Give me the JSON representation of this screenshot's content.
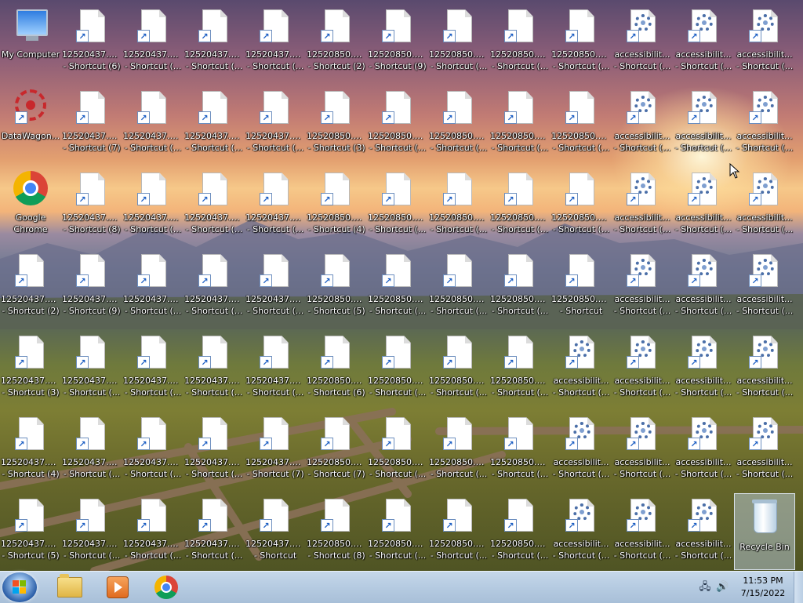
{
  "desktop": {
    "icons": [
      {
        "label1": "My Computer",
        "label2": "",
        "type": "computer"
      },
      {
        "label1": "12520437.cpx",
        "label2": "- Shortcut (6)",
        "type": "doc"
      },
      {
        "label1": "12520437.cpx",
        "label2": "- Shortcut (...",
        "type": "doc"
      },
      {
        "label1": "12520437.cpx",
        "label2": "- Shortcut (...",
        "type": "doc"
      },
      {
        "label1": "12520437.cpx",
        "label2": "- Shortcut (...",
        "type": "doc"
      },
      {
        "label1": "12520850.cpx",
        "label2": "- Shortcut (2)",
        "type": "doc"
      },
      {
        "label1": "12520850.cpx",
        "label2": "- Shortcut (9)",
        "type": "doc"
      },
      {
        "label1": "12520850.cpx",
        "label2": "- Shortcut (...",
        "type": "doc"
      },
      {
        "label1": "12520850.cpx",
        "label2": "- Shortcut (...",
        "type": "doc"
      },
      {
        "label1": "12520850.cpx",
        "label2": "- Shortcut (...",
        "type": "doc"
      },
      {
        "label1": "accessibilit...",
        "label2": "- Shortcut (...",
        "type": "gear"
      },
      {
        "label1": "accessibilit...",
        "label2": "- Shortcut (...",
        "type": "gear"
      },
      {
        "label1": "accessibilit...",
        "label2": "- Shortcut (...",
        "type": "gear"
      },
      {
        "label1": "DataWagon...",
        "label2": "",
        "type": "datawagon"
      },
      {
        "label1": "12520437.cpx",
        "label2": "- Shortcut (7)",
        "type": "doc"
      },
      {
        "label1": "12520437.cpx",
        "label2": "- Shortcut (...",
        "type": "doc"
      },
      {
        "label1": "12520437.cpx",
        "label2": "- Shortcut (...",
        "type": "doc"
      },
      {
        "label1": "12520437.cpx",
        "label2": "- Shortcut (...",
        "type": "doc"
      },
      {
        "label1": "12520850.cpx",
        "label2": "- Shortcut (3)",
        "type": "doc"
      },
      {
        "label1": "12520850.cpx",
        "label2": "- Shortcut (...",
        "type": "doc"
      },
      {
        "label1": "12520850.cpx",
        "label2": "- Shortcut (...",
        "type": "doc"
      },
      {
        "label1": "12520850.cpx",
        "label2": "- Shortcut (...",
        "type": "doc"
      },
      {
        "label1": "12520850.cpx",
        "label2": "- Shortcut (...",
        "type": "doc"
      },
      {
        "label1": "accessibilit...",
        "label2": "- Shortcut (...",
        "type": "gear"
      },
      {
        "label1": "accessibilit...",
        "label2": "- Shortcut (...",
        "type": "gear"
      },
      {
        "label1": "accessibilit...",
        "label2": "- Shortcut (...",
        "type": "gear"
      },
      {
        "label1": "Google",
        "label2": "Chrome",
        "type": "chrome"
      },
      {
        "label1": "12520437.cpx",
        "label2": "- Shortcut (8)",
        "type": "doc"
      },
      {
        "label1": "12520437.cpx",
        "label2": "- Shortcut (...",
        "type": "doc"
      },
      {
        "label1": "12520437.cpx",
        "label2": "- Shortcut (...",
        "type": "doc"
      },
      {
        "label1": "12520437.cpx",
        "label2": "- Shortcut (...",
        "type": "doc"
      },
      {
        "label1": "12520850.cpx",
        "label2": "- Shortcut (4)",
        "type": "doc"
      },
      {
        "label1": "12520850.cpx",
        "label2": "- Shortcut (...",
        "type": "doc"
      },
      {
        "label1": "12520850.cpx",
        "label2": "- Shortcut (...",
        "type": "doc"
      },
      {
        "label1": "12520850.cpx",
        "label2": "- Shortcut (...",
        "type": "doc"
      },
      {
        "label1": "12520850.cpx",
        "label2": "- Shortcut (...",
        "type": "doc"
      },
      {
        "label1": "accessibilit...",
        "label2": "- Shortcut (...",
        "type": "gear"
      },
      {
        "label1": "accessibilit...",
        "label2": "- Shortcut (...",
        "type": "gear"
      },
      {
        "label1": "accessibilit...",
        "label2": "- Shortcut (...",
        "type": "gear"
      },
      {
        "label1": "12520437.cpx",
        "label2": "- Shortcut (2)",
        "type": "doc"
      },
      {
        "label1": "12520437.cpx",
        "label2": "- Shortcut (9)",
        "type": "doc"
      },
      {
        "label1": "12520437.cpx",
        "label2": "- Shortcut (...",
        "type": "doc"
      },
      {
        "label1": "12520437.cpx",
        "label2": "- Shortcut (...",
        "type": "doc"
      },
      {
        "label1": "12520437.cpx",
        "label2": "- Shortcut (...",
        "type": "doc"
      },
      {
        "label1": "12520850.cpx",
        "label2": "- Shortcut (5)",
        "type": "doc"
      },
      {
        "label1": "12520850.cpx",
        "label2": "- Shortcut (...",
        "type": "doc"
      },
      {
        "label1": "12520850.cpx",
        "label2": "- Shortcut (...",
        "type": "doc"
      },
      {
        "label1": "12520850.cpx",
        "label2": "- Shortcut (...",
        "type": "doc"
      },
      {
        "label1": "12520850.cpx",
        "label2": "- Shortcut",
        "type": "doc"
      },
      {
        "label1": "accessibilit...",
        "label2": "- Shortcut (...",
        "type": "gear"
      },
      {
        "label1": "accessibilit...",
        "label2": "- Shortcut (...",
        "type": "gear"
      },
      {
        "label1": "accessibilit...",
        "label2": "- Shortcut (...",
        "type": "gear"
      },
      {
        "label1": "12520437.cpx",
        "label2": "- Shortcut (3)",
        "type": "doc"
      },
      {
        "label1": "12520437.cpx",
        "label2": "- Shortcut (...",
        "type": "doc"
      },
      {
        "label1": "12520437.cpx",
        "label2": "- Shortcut (...",
        "type": "doc"
      },
      {
        "label1": "12520437.cpx",
        "label2": "- Shortcut (...",
        "type": "doc"
      },
      {
        "label1": "12520437.cpx",
        "label2": "- Shortcut (...",
        "type": "doc"
      },
      {
        "label1": "12520850.cpx",
        "label2": "- Shortcut (6)",
        "type": "doc"
      },
      {
        "label1": "12520850.cpx",
        "label2": "- Shortcut (...",
        "type": "doc"
      },
      {
        "label1": "12520850.cpx",
        "label2": "- Shortcut (...",
        "type": "doc"
      },
      {
        "label1": "12520850.cpx",
        "label2": "- Shortcut (...",
        "type": "doc"
      },
      {
        "label1": "accessibilit...",
        "label2": "- Shortcut (...",
        "type": "gear"
      },
      {
        "label1": "accessibilit...",
        "label2": "- Shortcut (...",
        "type": "gear"
      },
      {
        "label1": "accessibilit...",
        "label2": "- Shortcut (...",
        "type": "gear"
      },
      {
        "label1": "accessibilit...",
        "label2": "- Shortcut (...",
        "type": "gear"
      },
      {
        "label1": "12520437.cpx",
        "label2": "- Shortcut (4)",
        "type": "doc"
      },
      {
        "label1": "12520437.cpx",
        "label2": "- Shortcut (...",
        "type": "doc"
      },
      {
        "label1": "12520437.cpx",
        "label2": "- Shortcut (...",
        "type": "doc"
      },
      {
        "label1": "12520437.cpx",
        "label2": "- Shortcut (...",
        "type": "doc"
      },
      {
        "label1": "12520437.cpx",
        "label2": "- Shortcut (7)",
        "type": "doc"
      },
      {
        "label1": "12520850.cpx",
        "label2": "- Shortcut (7)",
        "type": "doc"
      },
      {
        "label1": "12520850.cpx",
        "label2": "- Shortcut (...",
        "type": "doc"
      },
      {
        "label1": "12520850.cpx",
        "label2": "- Shortcut (...",
        "type": "doc"
      },
      {
        "label1": "12520850.cpx",
        "label2": "- Shortcut (...",
        "type": "doc"
      },
      {
        "label1": "accessibilit...",
        "label2": "- Shortcut (...",
        "type": "gear"
      },
      {
        "label1": "accessibilit...",
        "label2": "- Shortcut (...",
        "type": "gear"
      },
      {
        "label1": "accessibilit...",
        "label2": "- Shortcut (...",
        "type": "gear"
      },
      {
        "label1": "accessibilit...",
        "label2": "- Shortcut (...",
        "type": "gear"
      },
      {
        "label1": "12520437.cpx",
        "label2": "- Shortcut (5)",
        "type": "doc"
      },
      {
        "label1": "12520437.cpx",
        "label2": "- Shortcut (...",
        "type": "doc"
      },
      {
        "label1": "12520437.cpx",
        "label2": "- Shortcut (...",
        "type": "doc"
      },
      {
        "label1": "12520437.cpx",
        "label2": "- Shortcut (...",
        "type": "doc"
      },
      {
        "label1": "12520437.cpx",
        "label2": "- Shortcut",
        "type": "doc"
      },
      {
        "label1": "12520850.cpx",
        "label2": "- Shortcut (8)",
        "type": "doc"
      },
      {
        "label1": "12520850.cpx",
        "label2": "- Shortcut (...",
        "type": "doc"
      },
      {
        "label1": "12520850.cpx",
        "label2": "- Shortcut (...",
        "type": "doc"
      },
      {
        "label1": "12520850.cpx",
        "label2": "- Shortcut (...",
        "type": "doc"
      },
      {
        "label1": "accessibilit...",
        "label2": "- Shortcut (...",
        "type": "gear"
      },
      {
        "label1": "accessibilit...",
        "label2": "- Shortcut (...",
        "type": "gear"
      },
      {
        "label1": "accessibilit...",
        "label2": "- Shortcut (...",
        "type": "gear"
      },
      {
        "label1": "Recycle Bin",
        "label2": "",
        "type": "recyclebin",
        "selected": true
      }
    ]
  },
  "taskbar": {
    "start_icon": "windows-logo-icon",
    "pinned": [
      {
        "name": "windows-explorer",
        "icon": "folder-icon"
      },
      {
        "name": "media-player",
        "icon": "media-player-icon"
      },
      {
        "name": "google-chrome",
        "icon": "chrome-icon"
      }
    ]
  },
  "tray": {
    "network_icon": "network-icon",
    "volume_icon": "volume-icon",
    "time": "11:53 PM",
    "date": "7/15/2022"
  },
  "colors": {
    "taskbar": "#b7cce2",
    "label_text": "#ffffff",
    "shortcut_arrow": "#1d5fc4"
  }
}
